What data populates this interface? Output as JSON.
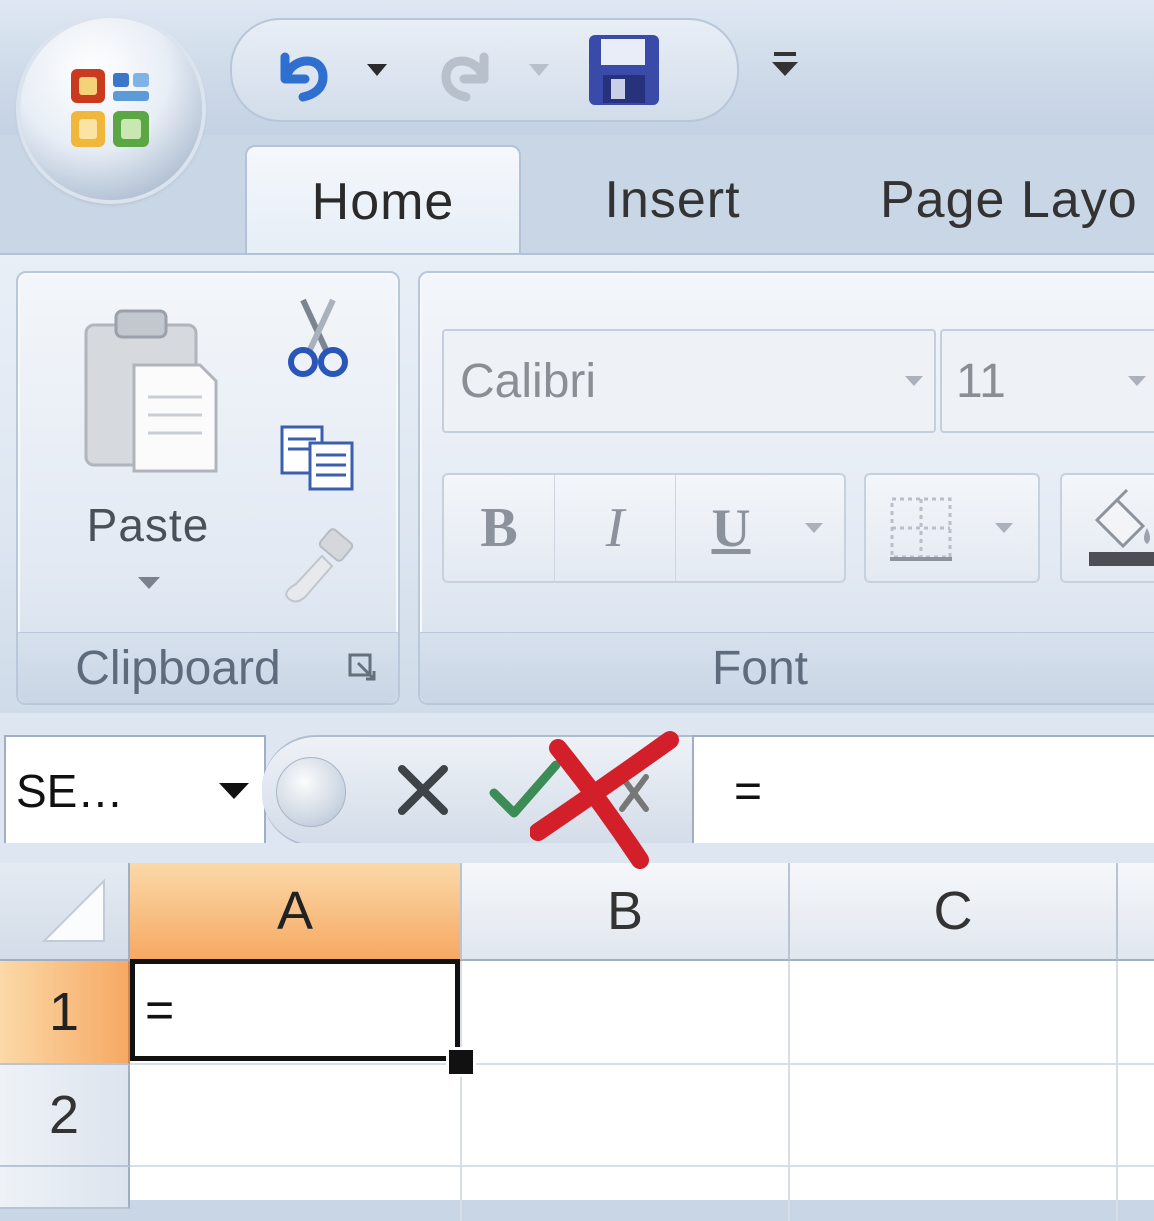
{
  "window": {
    "quick_access": [
      "undo",
      "redo",
      "save",
      "customize"
    ]
  },
  "tabs": [
    {
      "label": "Home",
      "active": true
    },
    {
      "label": "Insert",
      "active": false
    },
    {
      "label": "Page Layo",
      "active": false
    }
  ],
  "ribbon": {
    "clipboard": {
      "group_label": "Clipboard",
      "paste_label": "Paste",
      "small_buttons": [
        "cut-icon",
        "copy-icon",
        "format-painter-icon"
      ]
    },
    "font": {
      "group_label": "Font",
      "font_name": "Calibri",
      "font_size": "11",
      "bold_label": "B",
      "italic_label": "I",
      "underline_label": "U"
    }
  },
  "formula_bar": {
    "name_box": "SE…",
    "formula": "="
  },
  "grid": {
    "columns": [
      "A",
      "B",
      "C"
    ],
    "rows": [
      "1",
      "2"
    ],
    "active_cell": "A1",
    "active_cell_value": "="
  },
  "colors": {
    "selected_header": "#f6a963",
    "annotation_red": "#d31f2a",
    "enter_check": "#3c8c55"
  }
}
